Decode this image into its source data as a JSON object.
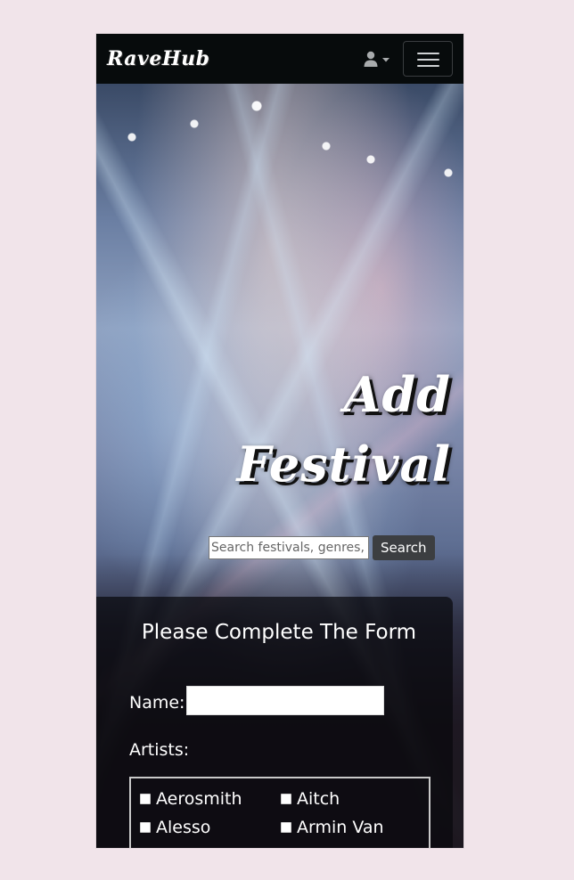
{
  "navbar": {
    "brand": "RaveHub",
    "user_icon": "user-icon",
    "caret_icon": "caret-down-icon",
    "menu_icon": "hamburger-menu-icon"
  },
  "hero": {
    "title_line1": "Add",
    "title_line2": "Festival",
    "search_placeholder": "Search festivals, genres, artists",
    "search_button": "Search"
  },
  "form": {
    "title": "Please Complete The Form",
    "name_label": "Name:",
    "name_value": "",
    "artists_label": "Artists:",
    "artists": [
      {
        "label": "Aerosmith",
        "checked": false
      },
      {
        "label": "Aitch",
        "checked": false
      },
      {
        "label": "Alesso",
        "checked": false
      },
      {
        "label": "Armin Van",
        "checked": false
      }
    ]
  },
  "colors": {
    "page_bg": "#f1e4ea",
    "navbar_bg": "#070b0c",
    "search_button_bg": "#3c3e41"
  }
}
